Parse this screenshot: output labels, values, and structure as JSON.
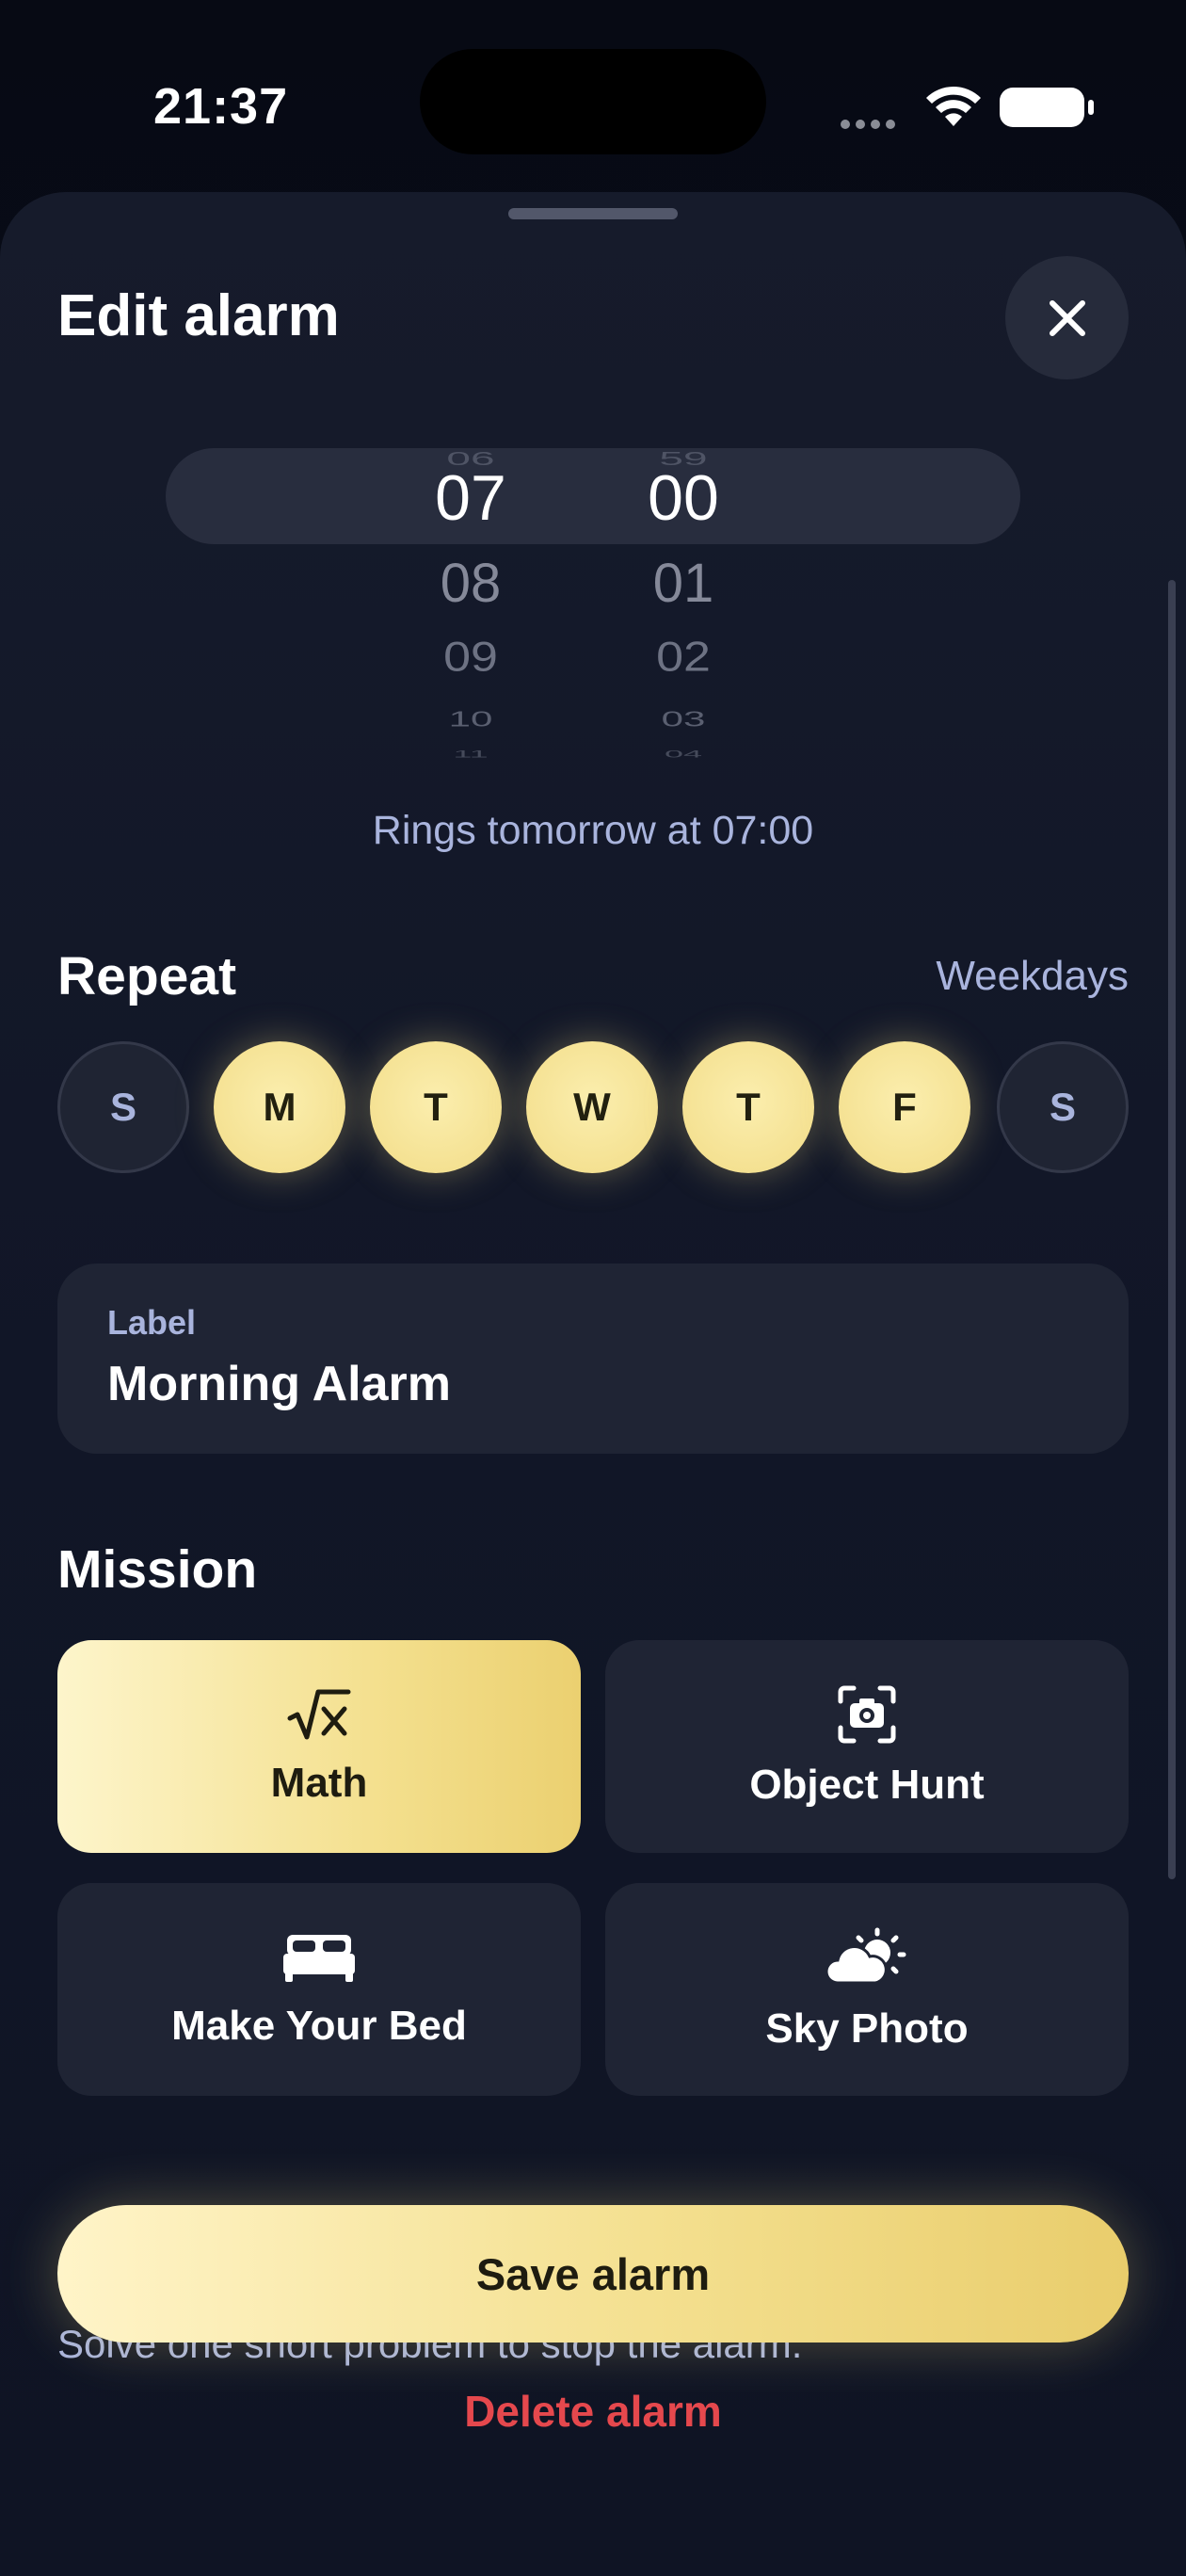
{
  "status_bar": {
    "time": "21:37"
  },
  "sheet": {
    "title": "Edit alarm",
    "close_icon": "close-icon"
  },
  "time_picker": {
    "hours": {
      "above": "06",
      "selected": "07",
      "below": [
        "08",
        "09",
        "10",
        "11"
      ]
    },
    "minutes": {
      "above": "59",
      "selected": "00",
      "below": [
        "01",
        "02",
        "03",
        "04"
      ]
    }
  },
  "rings_text": "Rings tomorrow at 07:00",
  "repeat": {
    "title": "Repeat",
    "summary": "Weekdays",
    "days": [
      {
        "label": "S",
        "active": false
      },
      {
        "label": "M",
        "active": true
      },
      {
        "label": "T",
        "active": true
      },
      {
        "label": "W",
        "active": true
      },
      {
        "label": "T",
        "active": true
      },
      {
        "label": "F",
        "active": true
      },
      {
        "label": "S",
        "active": false
      }
    ]
  },
  "label_field": {
    "caption": "Label",
    "value": "Morning Alarm"
  },
  "mission": {
    "title": "Mission",
    "options": [
      {
        "label": "Math",
        "icon": "square-root-icon",
        "selected": true
      },
      {
        "label": "Object Hunt",
        "icon": "camera-scan-icon",
        "selected": false
      },
      {
        "label": "Make Your Bed",
        "icon": "bed-icon",
        "selected": false
      },
      {
        "label": "Sky Photo",
        "icon": "sun-cloud-icon",
        "selected": false
      }
    ],
    "description": "Solve one short problem to stop the alarm."
  },
  "actions": {
    "save": "Save alarm",
    "delete": "Delete alarm"
  },
  "colors": {
    "accent": "#f4e08f",
    "danger": "#e5484d",
    "muted": "#a9b4dd",
    "card": "#1f2434"
  }
}
